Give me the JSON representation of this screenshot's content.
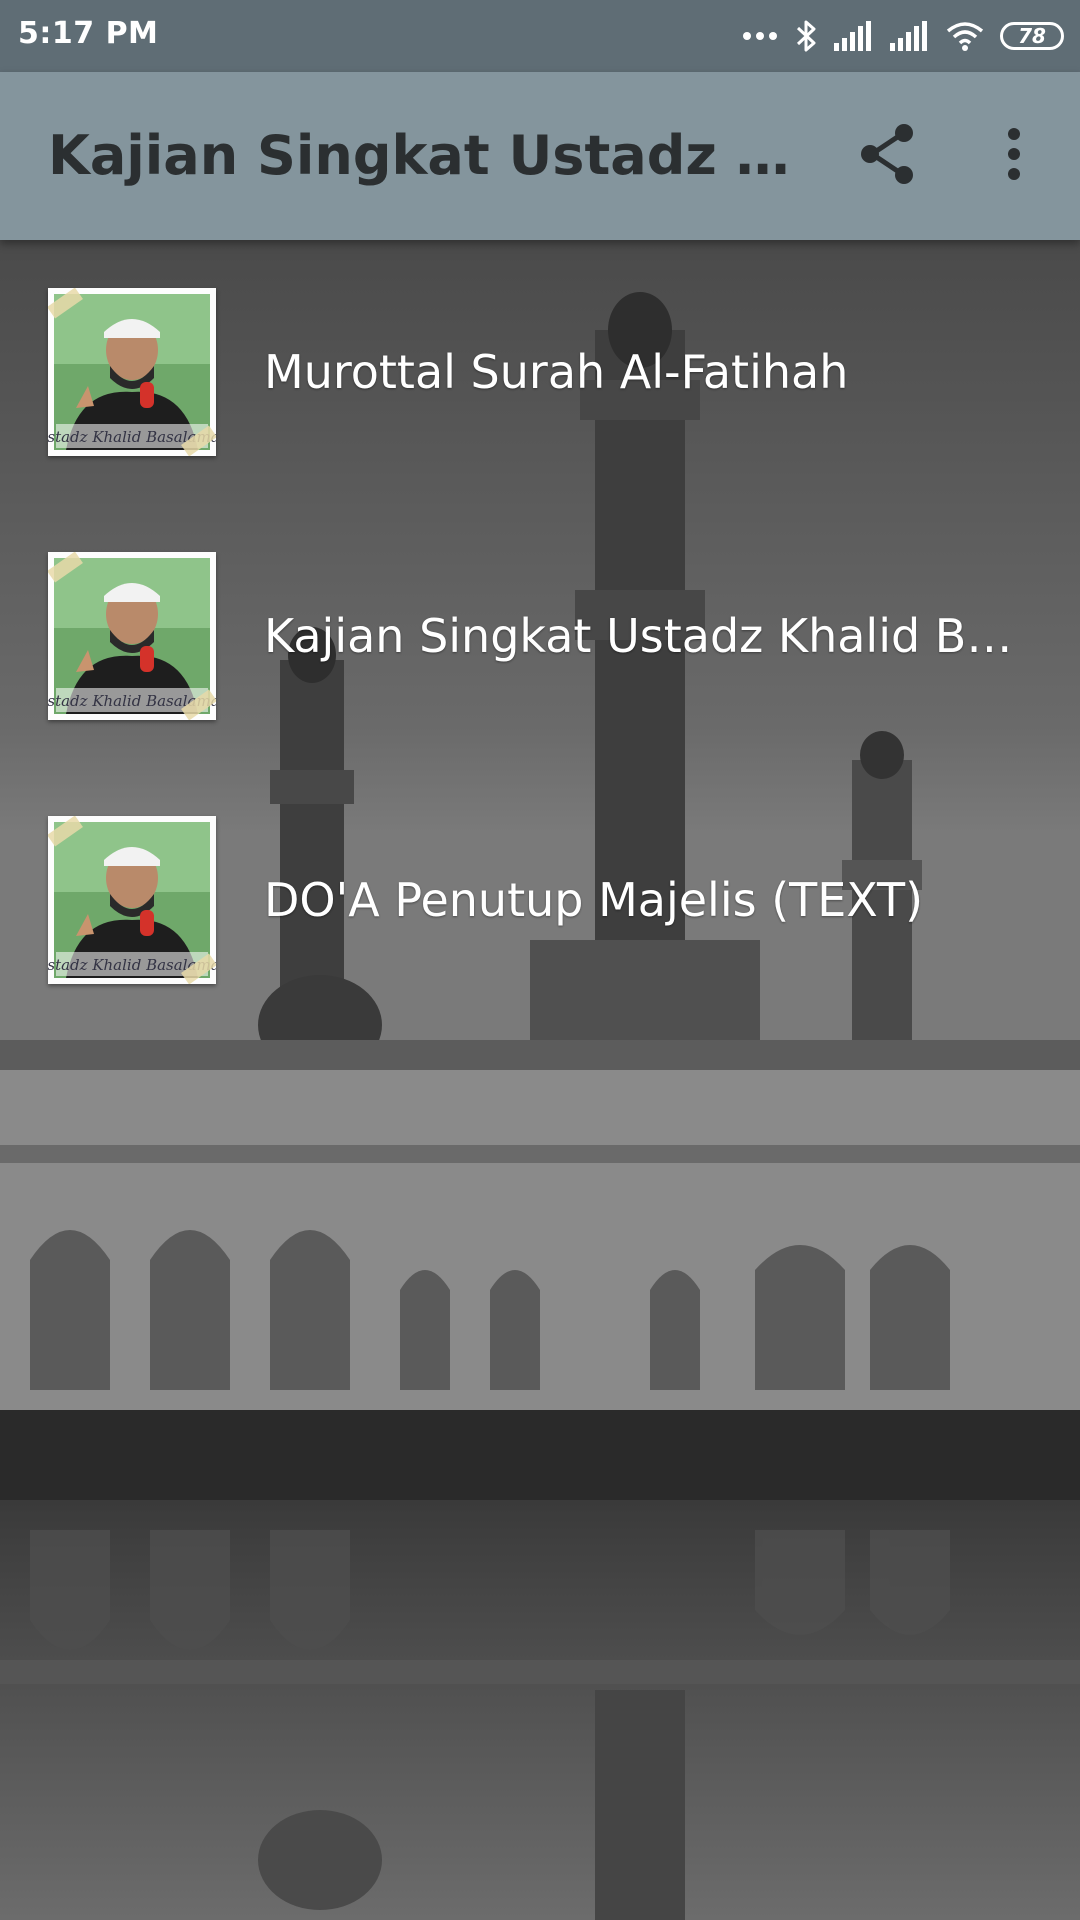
{
  "status_bar": {
    "time": "5:17 PM",
    "battery": "78",
    "icons": [
      "more-dots-icon",
      "bluetooth-icon",
      "signal-icon",
      "signal-icon",
      "wifi-icon",
      "battery-icon"
    ]
  },
  "app_bar": {
    "title": "Kajian Singkat Ustadz Khalid Basalamah",
    "actions": [
      "share-icon",
      "overflow-menu-icon"
    ]
  },
  "list": {
    "items": [
      {
        "label": "Murottal Surah Al-Fatihah",
        "thumb_caption": "Ustadz Khalid Basalamah"
      },
      {
        "label": "Kajian Singkat Ustadz Khalid Basalamah",
        "thumb_caption": "Ustadz Khalid Basalamah"
      },
      {
        "label": "DO'A Penutup Majelis (TEXT)",
        "thumb_caption": "Ustadz Khalid Basalamah"
      }
    ]
  },
  "colors": {
    "status_bar": "#5f6d75",
    "app_bar": "#84959d",
    "title_text": "#2b2f31",
    "list_text": "#ffffff"
  }
}
